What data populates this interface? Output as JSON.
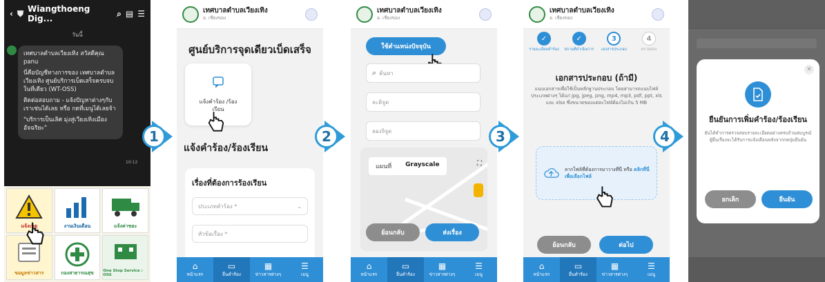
{
  "colors": {
    "accent": "#2f8fd6",
    "arrow": "#2f9bd8",
    "line_green": "#06c755"
  },
  "arrows": [
    "1",
    "2",
    "3",
    "4"
  ],
  "panel1": {
    "chat_title": "Wiangthoeng Dig...",
    "day": "วันนี้",
    "messages": [
      "เทศบาลตำบลเวียงเทิง สวัสดีคุณ panu",
      "นี่คือบัญชีทางการของ เทศบาลตำบลเวียงเทิง ศูนย์บริการเบ็ดเสร็จครบจบในที่เดียว (WT-OSS)",
      "ติดต่อสอบถาม - แจ้งปัญหาต่างๆกับเราเช่นได้เลย หรือ กดที่เมนูได้เลยจ้า",
      "\"บริการเป็นเลิศ มุ่งสู่เวียงเทิงเมืองอัจฉริยะ\""
    ],
    "time": "10:12",
    "tiles": [
      "แจ้งเหตุ",
      "งานเงินเดือน",
      "แจ้งค่าขยะ",
      "ขอมูลข่าวสาร",
      "กองสาธารณสุข",
      "One Stop Service : OSS"
    ]
  },
  "header": {
    "brand": "เทศบาลตำบลเวียงเทิง",
    "sub": "อ. เชียงของ"
  },
  "nav": [
    "หน้าแรก",
    "ยื่นคำร้อง",
    "ข่าวสารต่างๆ",
    "เมนู"
  ],
  "panel2": {
    "title": "ศูนย์บริการจุดเดียวเบ็ดเสร็จ",
    "card_label": "แจ้งคำร้อง /ร้องเรียน",
    "section": "แจ้งคำร้อง/ร้องเรียน",
    "form_label": "เรื่องที่ต้องการร้องเรียน",
    "field1": "ประเภทคำร้อง *",
    "field2": "หัวข้อเรื่อง *"
  },
  "panel3": {
    "locate": "ใช้ตำแหน่งปัจจุบัน",
    "search": "ค้นหา",
    "lat": "ละติจูด",
    "lng": "ลองจิจูด",
    "map_tab1": "แผนที่",
    "map_tab2": "Grayscale",
    "back": "ย้อนกลับ",
    "submit": "ส่งเรื่อง"
  },
  "panel4": {
    "steps": [
      "รายละเอียดคำร้อง",
      "สถานที่ดำเนินการ",
      "เอกสารประกอบ",
      "ตรวจสอบ"
    ],
    "step_nums": [
      "✓",
      "✓",
      "3",
      "4"
    ],
    "title": "เอกสารประกอบ (ถ้ามี)",
    "desc": "แนบเอกสารเพื่อใช้เป็นหลักฐานประกอบ โดยสามารถแนบไฟล์ประเภทต่างๆ ได้แก่ jpg, jpeg, png, mp4, mp3, pdf, ppt, xls และ xlsx ซึ่งขนาดของแต่ละไฟล์ต้องไม่เกิน 5 MB",
    "drop_text": "ลากไฟล์ที่ต้องการมาวางที่นี่ หรือ",
    "drop_link": "คลิกที่นี่เพื่อเลือกไฟล์",
    "back": "ย้อนกลับ",
    "next": "ต่อไป"
  },
  "panel5": {
    "title": "ยืนยันการเพิ่มคำร้อง/ร้องเรียน",
    "desc": "ยันได้ทำการตรวจสอบรายละเอียดอย่างครบถ้วนสมบูรณ์ ผู้ยื่นเรื่องจะได้รับการแจ้งเตือนหลังจากกดปุ่มยืนยัน",
    "cancel": "ยกเลิก",
    "confirm": "ยืนยัน"
  }
}
